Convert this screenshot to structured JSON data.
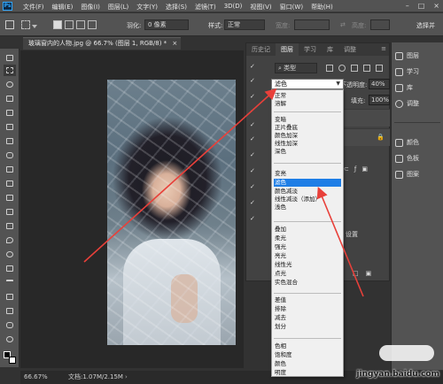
{
  "app": {
    "logo_text": "Ps"
  },
  "menubar": {
    "items": [
      "文件(F)",
      "编辑(E)",
      "图像(I)",
      "图层(L)",
      "文字(Y)",
      "选择(S)",
      "滤镜(T)",
      "3D(D)",
      "视图(V)",
      "窗口(W)",
      "帮助(H)"
    ],
    "window_controls": [
      "–",
      "□",
      "×"
    ]
  },
  "optionsbar": {
    "feather_label": "羽化:",
    "feather_value": "0 像素",
    "style_label": "样式:",
    "style_value": "正常",
    "width_label": "宽度:",
    "height_label": "高度:",
    "select_label": "选择并"
  },
  "document": {
    "tab_title": "玻璃窗内的人物.jpg @ 66.7% (图层 1, RGB/8) *",
    "tab_close": "×"
  },
  "statusbar": {
    "zoom": "66.67%",
    "doc_info": "文档:1.07M/2.15M"
  },
  "layers_panel": {
    "tabs": [
      "历史记",
      "图层",
      "学习",
      "库",
      "调整"
    ],
    "active_tab": "图层",
    "kind_label": "类型",
    "blend_mode": "滤色",
    "opacity_label": "不透明度:",
    "opacity_value": "40%",
    "fill_label": "填充:",
    "fill_value": "100%",
    "layer_partial_label": "设置"
  },
  "blend_dropdown": {
    "groups": [
      [
        "正常",
        "溶解"
      ],
      [
        "变暗",
        "正片叠底",
        "颜色加深",
        "线性加深",
        "深色"
      ],
      [
        "变亮",
        "滤色",
        "颜色减淡",
        "线性减淡（添加）",
        "浅色"
      ],
      [
        "叠加",
        "柔光",
        "强光",
        "亮光",
        "线性光",
        "点光",
        "实色混合"
      ],
      [
        "差值",
        "排除",
        "减去",
        "划分"
      ],
      [
        "色相",
        "饱和度",
        "颜色",
        "明度"
      ]
    ],
    "highlighted": "滤色"
  },
  "dock": {
    "items": [
      "图层",
      "学习",
      "库",
      "调整",
      "颜色",
      "色板",
      "图案"
    ]
  },
  "watermark": {
    "site": "jingyan.baidu.com"
  },
  "colors": {
    "ui_dark": "#535353",
    "highlight": "#1e7ee6",
    "arrow": "#e8403a"
  }
}
